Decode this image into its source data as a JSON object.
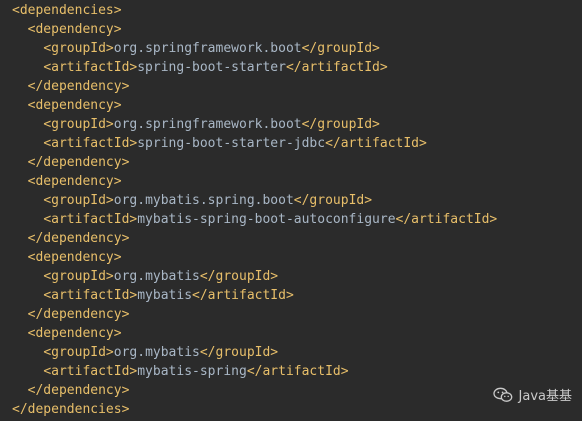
{
  "editor": {
    "lines": [
      {
        "indent": "",
        "open": "<dependencies>",
        "value": "",
        "close": ""
      },
      {
        "indent": "  ",
        "open": "<dependency>",
        "value": "",
        "close": ""
      },
      {
        "indent": "    ",
        "open": "<groupId>",
        "value": "org.springframework.boot",
        "close": "</groupId>"
      },
      {
        "indent": "    ",
        "open": "<artifactId>",
        "value": "spring-boot-starter",
        "close": "</artifactId>"
      },
      {
        "indent": "  ",
        "open": "</dependency>",
        "value": "",
        "close": ""
      },
      {
        "indent": "  ",
        "open": "<dependency>",
        "value": "",
        "close": ""
      },
      {
        "indent": "    ",
        "open": "<groupId>",
        "value": "org.springframework.boot",
        "close": "</groupId>"
      },
      {
        "indent": "    ",
        "open": "<artifactId>",
        "value": "spring-boot-starter-jdbc",
        "close": "</artifactId>"
      },
      {
        "indent": "  ",
        "open": "</dependency>",
        "value": "",
        "close": ""
      },
      {
        "indent": "  ",
        "open": "<dependency>",
        "value": "",
        "close": ""
      },
      {
        "indent": "    ",
        "open": "<groupId>",
        "value": "org.mybatis.spring.boot",
        "close": "</groupId>"
      },
      {
        "indent": "    ",
        "open": "<artifactId>",
        "value": "mybatis-spring-boot-autoconfigure",
        "close": "</artifactId>"
      },
      {
        "indent": "  ",
        "open": "</dependency>",
        "value": "",
        "close": ""
      },
      {
        "indent": "  ",
        "open": "<dependency>",
        "value": "",
        "close": ""
      },
      {
        "indent": "    ",
        "open": "<groupId>",
        "value": "org.mybatis",
        "close": "</groupId>"
      },
      {
        "indent": "    ",
        "open": "<artifactId>",
        "value": "mybatis",
        "close": "</artifactId>"
      },
      {
        "indent": "  ",
        "open": "</dependency>",
        "value": "",
        "close": ""
      },
      {
        "indent": "  ",
        "open": "<dependency>",
        "value": "",
        "close": ""
      },
      {
        "indent": "    ",
        "open": "<groupId>",
        "value": "org.mybatis",
        "close": "</groupId>"
      },
      {
        "indent": "    ",
        "open": "<artifactId>",
        "value": "mybatis-spring",
        "close": "</artifactId>"
      },
      {
        "indent": "  ",
        "open": "</dependency>",
        "value": "",
        "close": ""
      },
      {
        "indent": "",
        "open": "</dependencies>",
        "value": "",
        "close": ""
      }
    ]
  },
  "watermark": {
    "text": "Java基基",
    "icon": "wechat-icon"
  },
  "colors": {
    "background": "#2b2b2b",
    "tag": "#e8bf6a",
    "text": "#a9b7c6",
    "watermark": "#d8d8d8"
  }
}
